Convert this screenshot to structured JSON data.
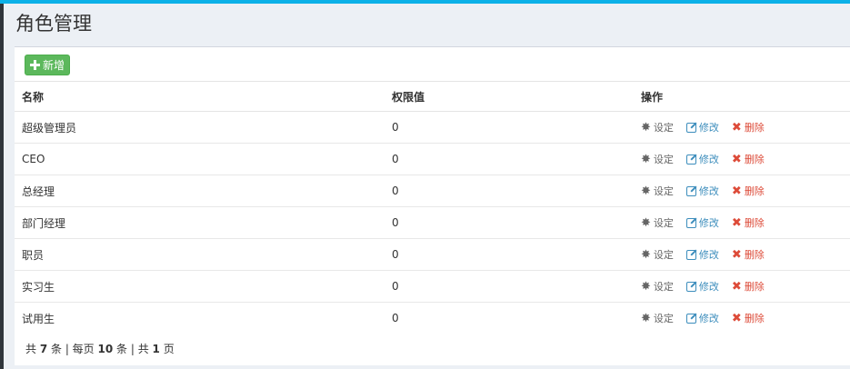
{
  "page": {
    "title": "角色管理"
  },
  "toolbar": {
    "add_label": "新增",
    "add_icon": "plus-icon"
  },
  "table": {
    "headers": [
      "名称",
      "权限值",
      "操作"
    ],
    "rows": [
      {
        "name": "超级管理员",
        "perm": "0"
      },
      {
        "name": "CEO",
        "perm": "0"
      },
      {
        "name": "总经理",
        "perm": "0"
      },
      {
        "name": "部门经理",
        "perm": "0"
      },
      {
        "name": "职员",
        "perm": "0"
      },
      {
        "name": "实习生",
        "perm": "0"
      },
      {
        "name": "试用生",
        "perm": "0"
      }
    ],
    "actions": {
      "set": "设定",
      "edit": "修改",
      "delete": "删除"
    }
  },
  "pagination": {
    "p1": "共 ",
    "total": "7",
    "p2": " 条 | 每页 ",
    "per_page": "10",
    "p3": " 条 | 共 ",
    "pages": "1",
    "p4": " 页"
  },
  "colors": {
    "accent_bar": "#0cb1e8",
    "add_button": "#5cb85c",
    "edit_link": "#3c8dbc",
    "delete_link": "#dd4b39"
  }
}
